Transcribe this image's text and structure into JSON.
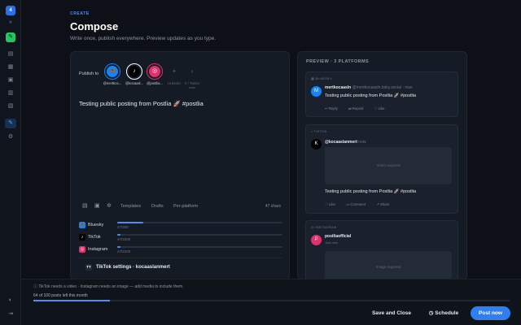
{
  "app": {
    "logo_letter": "4"
  },
  "sidebar": {
    "items": [
      {
        "name": "collapse-icon",
        "glyph": "»"
      },
      {
        "name": "compose-icon",
        "glyph": "✎"
      },
      {
        "name": "posts-icon",
        "glyph": "▤"
      },
      {
        "name": "calendar-icon",
        "glyph": "▦"
      },
      {
        "name": "media-icon",
        "glyph": "▣"
      },
      {
        "name": "analytics-icon",
        "glyph": "▥"
      },
      {
        "name": "inbox-icon",
        "glyph": "▧"
      },
      {
        "name": "edit-icon",
        "glyph": "✎"
      },
      {
        "name": "settings-icon",
        "glyph": "⚙"
      }
    ],
    "bottom": [
      {
        "name": "theme-icon",
        "glyph": "◐"
      },
      {
        "name": "logout-icon",
        "glyph": "⇥"
      }
    ]
  },
  "header": {
    "eyebrow": "CREATE",
    "title": "Compose",
    "subtitle": "Write once, publish everywhere. Preview updates as you type."
  },
  "compose": {
    "publish_label": "Publish to",
    "accounts": [
      {
        "name": "@mertkoc...",
        "glyph": "🦋",
        "color": "#1185fe",
        "ring": "#1185fe"
      },
      {
        "name": "@kocaasl...",
        "glyph": "♪",
        "color": "#000000",
        "ring": "#ffffff"
      },
      {
        "name": "@postlia...",
        "glyph": "◎",
        "color": "#e1306c",
        "ring": "#e1306c"
      }
    ],
    "disabled_accounts": [
      {
        "name": "LinkedIn",
        "glyph": "+",
        "sub": ""
      },
      {
        "name": "X / Twitter",
        "glyph": "›",
        "sub": "soon"
      }
    ],
    "text": "Testing public posting from Postlia 🚀 #postlia",
    "toolbar": {
      "templates": "Templates",
      "drafts": "Drafts",
      "per_platform": "Per-platform",
      "chars": "47 chars"
    },
    "platforms": [
      {
        "label": "Bluesky",
        "count": "47/300",
        "fraction": 0.157,
        "color": "#1185fe",
        "glyph": "🦋"
      },
      {
        "label": "TikTok",
        "count": "47/2200",
        "fraction": 0.021,
        "color": "#000000",
        "glyph": "♪"
      },
      {
        "label": "Instagram",
        "count": "47/2200",
        "fraction": 0.021,
        "color": "#e1306c",
        "glyph": "◎"
      }
    ],
    "tiktok_settings": {
      "icon_label": "TT",
      "title": "TikTok settings · kocaaslanmert"
    }
  },
  "preview": {
    "heading": "PREVIEW · 3 PLATFORMS",
    "bluesky": {
      "platform": "BLUESKY",
      "avatar": "M",
      "name": "mertkocaasln",
      "handle": "@mertkocaasln.bsky.social · now",
      "text": "Testing public posting from Postlia 🚀 #postlia",
      "actions": [
        "Reply",
        "Repost",
        "Like"
      ]
    },
    "tiktok": {
      "platform": "TIKTOK",
      "avatar": "K",
      "name": "@kocaaslanmert",
      "time": "now",
      "media": "Video required",
      "text": "Testing public posting from Postlia 🚀 #postlia",
      "actions": [
        "Like",
        "Comment",
        "Share"
      ]
    },
    "instagram": {
      "platform": "INSTAGRAM",
      "avatar": "P",
      "name": "postliaofficial",
      "handle": "Just now",
      "media": "Image required"
    }
  },
  "footer": {
    "warning": "TikTok needs a video · Instagram needs an image — add media to include them.",
    "quota": "64 of 100 posts left this month",
    "quota_fraction": 0.16,
    "save": "Save and Close",
    "schedule": "Schedule",
    "post": "Post now"
  }
}
